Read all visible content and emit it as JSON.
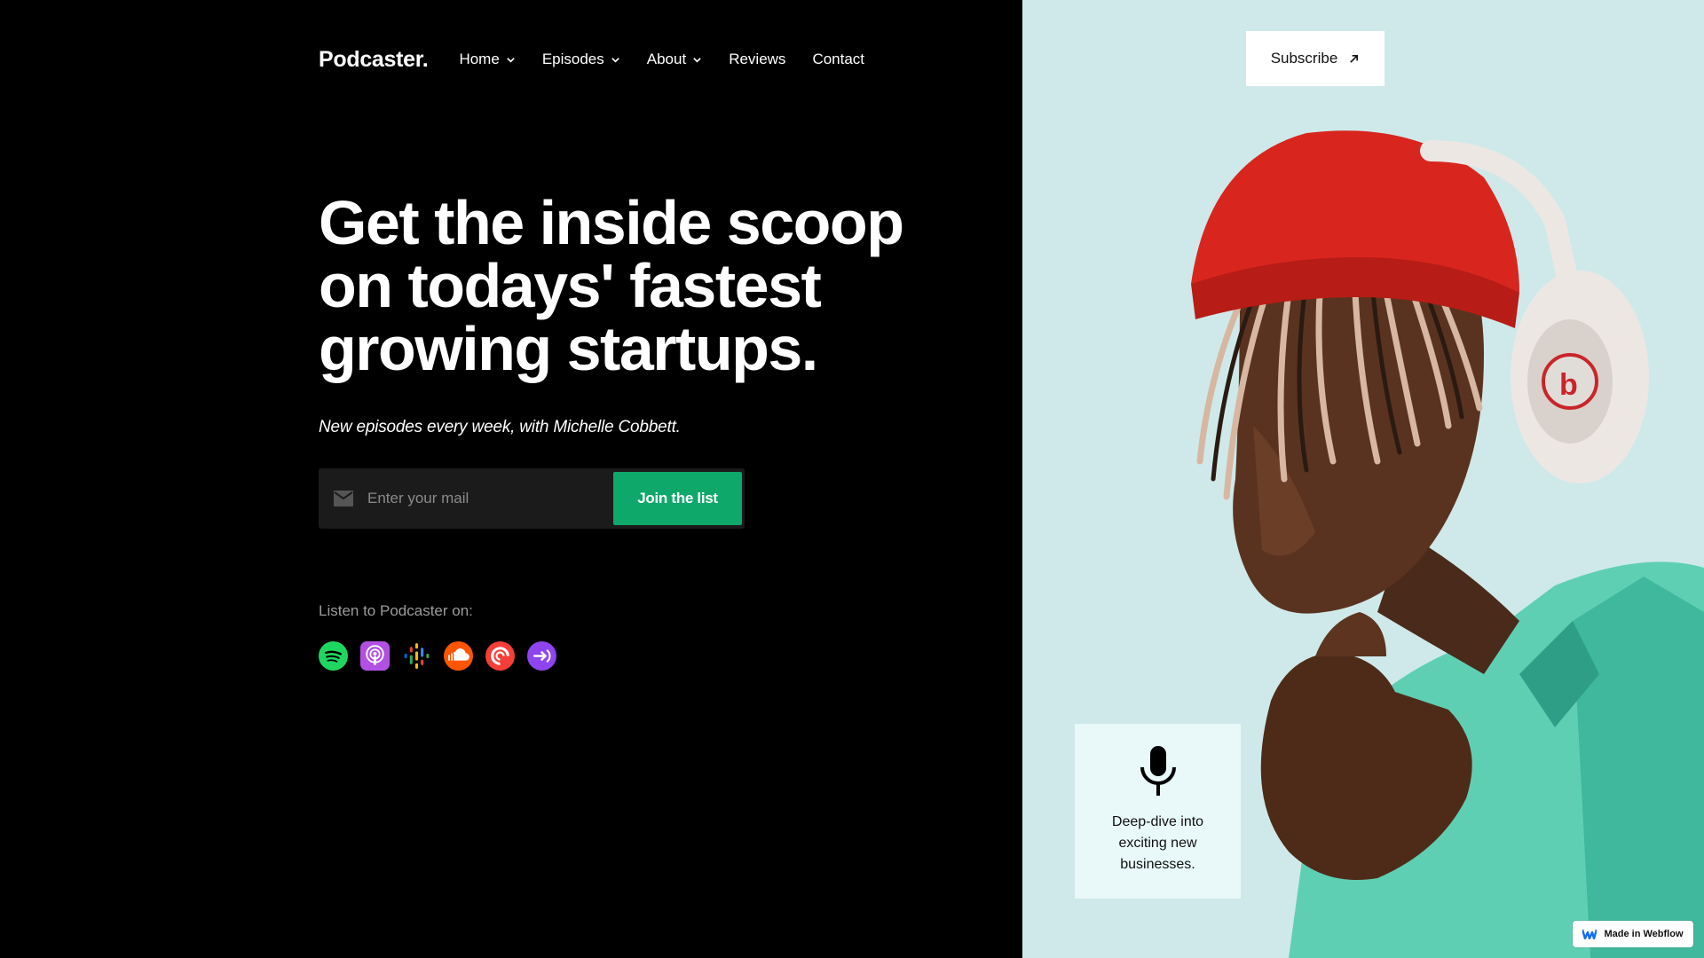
{
  "brand": {
    "logo": "Podcaster."
  },
  "nav": {
    "items": [
      {
        "label": "Home",
        "dropdown": true
      },
      {
        "label": "Episodes",
        "dropdown": true
      },
      {
        "label": "About",
        "dropdown": true
      },
      {
        "label": "Reviews",
        "dropdown": false
      },
      {
        "label": "Contact",
        "dropdown": false
      }
    ]
  },
  "header": {
    "subscribe_label": "Subscribe"
  },
  "hero": {
    "title_line1": "Get the inside scoop",
    "title_line2": "on todays' fastest",
    "title_line3": "growing startups.",
    "subtitle": "New episodes every week, with Michelle Cobbett."
  },
  "signup": {
    "placeholder": "Enter your mail",
    "value": "",
    "button_label": "Join the list"
  },
  "listen": {
    "label": "Listen to Podcaster on:",
    "platforms": [
      {
        "icon": "spotify-icon",
        "color": "#1ed760"
      },
      {
        "icon": "apple-podcasts-icon",
        "color": "#b150e2"
      },
      {
        "icon": "google-podcasts-icon",
        "color": "#4285f4"
      },
      {
        "icon": "soundcloud-icon",
        "color": "#ff5500"
      },
      {
        "icon": "pocket-casts-icon",
        "color": "#f43e37"
      },
      {
        "icon": "castbox-icon",
        "color": "#8e44ef"
      }
    ]
  },
  "feature_card": {
    "icon": "microphone-icon",
    "text": "Deep-dive into exciting new businesses."
  },
  "badge": {
    "label": "Made in Webflow"
  },
  "colors": {
    "accent": "#0ea86b",
    "left_bg": "#000000",
    "right_bg": "#cfe9ea"
  }
}
